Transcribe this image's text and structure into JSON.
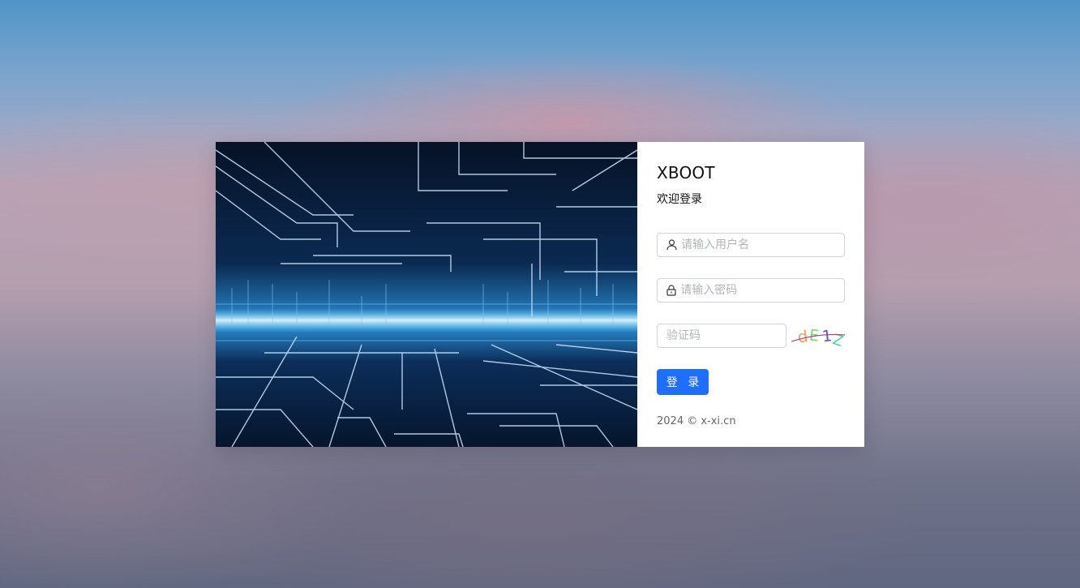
{
  "app_title": "XBOOT",
  "subtitle": "欢迎登录",
  "form": {
    "username": {
      "placeholder": "请输入用户名",
      "value": "",
      "icon": "user-icon"
    },
    "password": {
      "placeholder": "请输入密码",
      "value": "",
      "icon": "lock-icon"
    },
    "captcha": {
      "placeholder": "验证码",
      "value": "",
      "image_text": "dE1Z"
    },
    "submit_label": "登 录"
  },
  "footer": "2024 © x-xi.cn",
  "colors": {
    "primary": "#1e6fff",
    "panel_bg": "#ffffff",
    "input_border": "#d0d3d9",
    "placeholder": "#b0b3b8",
    "footer_text": "#666666"
  }
}
